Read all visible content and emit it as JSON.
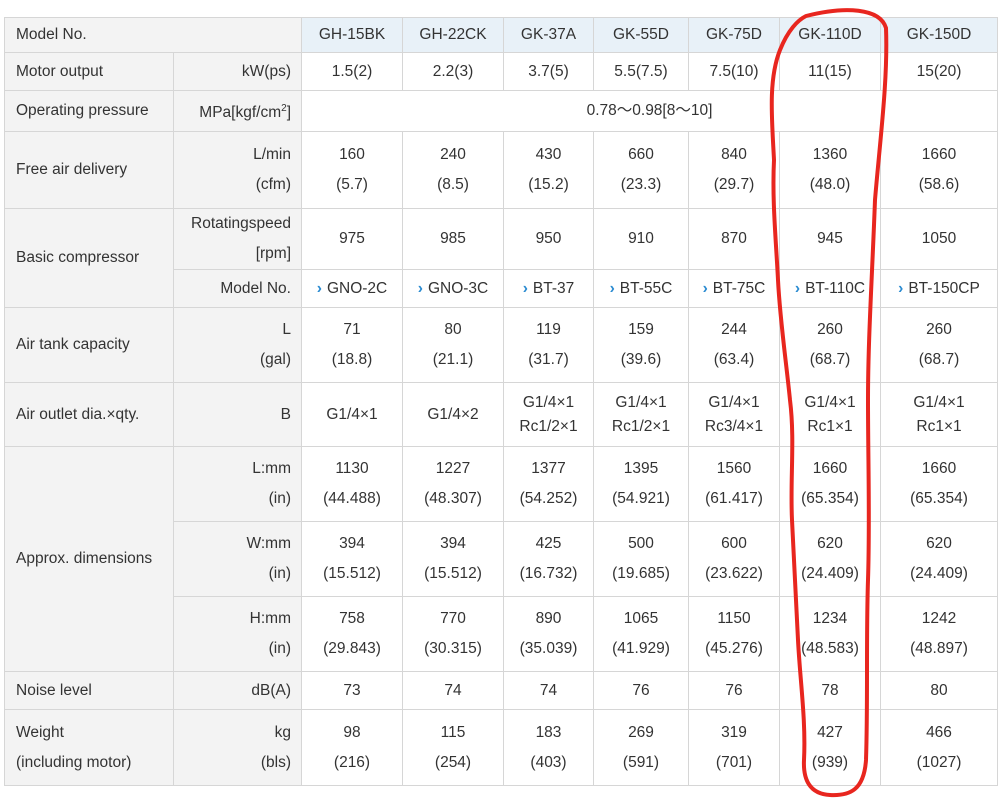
{
  "header": {
    "label": "Model No.",
    "models": [
      "GH-15BK",
      "GH-22CK",
      "GK-37A",
      "GK-55D",
      "GK-75D",
      "GK-110D",
      "GK-150D"
    ]
  },
  "motor_output": {
    "label": "Motor output",
    "unit": "kW(ps)",
    "values": [
      "1.5(2)",
      "2.2(3)",
      "3.7(5)",
      "5.5(7.5)",
      "7.5(10)",
      "11(15)",
      "15(20)"
    ]
  },
  "operating_pressure": {
    "label": "Operating pressure",
    "unit_prefix": "MPa[kgf/cm",
    "unit_sup": "2",
    "unit_suffix": "]",
    "value": "0.78〜0.98[8〜10]"
  },
  "free_air_delivery": {
    "label": "Free air delivery",
    "unit1": "L/min",
    "unit2": "(cfm)",
    "values1": [
      "160",
      "240",
      "430",
      "660",
      "840",
      "1360",
      "1660"
    ],
    "values2": [
      "(5.7)",
      "(8.5)",
      "(15.2)",
      "(23.3)",
      "(29.7)",
      "(48.0)",
      "(58.6)"
    ]
  },
  "basic_compressor": {
    "label": "Basic compressor",
    "speed_unit1": "Rotatingspeed",
    "speed_unit2": "[rpm]",
    "speed_values": [
      "975",
      "985",
      "950",
      "910",
      "870",
      "945",
      "1050"
    ],
    "model_unit": "Model No.",
    "model_links": [
      "GNO-2C",
      "GNO-3C",
      "BT-37",
      "BT-55C",
      "BT-75C",
      "BT-110C",
      "BT-150CP"
    ]
  },
  "air_tank": {
    "label": "Air tank capacity",
    "unit1": "L",
    "unit2": "(gal)",
    "values1": [
      "71",
      "80",
      "119",
      "159",
      "244",
      "260",
      "260"
    ],
    "values2": [
      "(18.8)",
      "(21.1)",
      "(31.7)",
      "(39.6)",
      "(63.4)",
      "(68.7)",
      "(68.7)"
    ]
  },
  "air_outlet": {
    "label": "Air outlet dia.×qty.",
    "unit": "B",
    "lines1": [
      "G1/4×1",
      "G1/4×2",
      "G1/4×1",
      "G1/4×1",
      "G1/4×1",
      "G1/4×1",
      "G1/4×1"
    ],
    "lines2": [
      "",
      "",
      "Rc1/2×1",
      "Rc1/2×1",
      "Rc3/4×1",
      "Rc1×1",
      "Rc1×1"
    ]
  },
  "dimensions": {
    "label": "Approx. dimensions",
    "L": {
      "unit1": "L:mm",
      "unit2": "(in)",
      "values1": [
        "1130",
        "1227",
        "1377",
        "1395",
        "1560",
        "1660",
        "1660"
      ],
      "values2": [
        "(44.488)",
        "(48.307)",
        "(54.252)",
        "(54.921)",
        "(61.417)",
        "(65.354)",
        "(65.354)"
      ]
    },
    "W": {
      "unit1": "W:mm",
      "unit2": "(in)",
      "values1": [
        "394",
        "394",
        "425",
        "500",
        "600",
        "620",
        "620"
      ],
      "values2": [
        "(15.512)",
        "(15.512)",
        "(16.732)",
        "(19.685)",
        "(23.622)",
        "(24.409)",
        "(24.409)"
      ]
    },
    "H": {
      "unit1": "H:mm",
      "unit2": "(in)",
      "values1": [
        "758",
        "770",
        "890",
        "1065",
        "1150",
        "1234",
        "1242"
      ],
      "values2": [
        "(29.843)",
        "(30.315)",
        "(35.039)",
        "(41.929)",
        "(45.276)",
        "(48.583)",
        "(48.897)"
      ]
    }
  },
  "noise": {
    "label": "Noise level",
    "unit": "dB(A)",
    "values": [
      "73",
      "74",
      "74",
      "76",
      "76",
      "78",
      "80"
    ]
  },
  "weight": {
    "label1": "Weight",
    "label2": "(including motor)",
    "unit1": "kg",
    "unit2": "(bls)",
    "values1": [
      "98",
      "115",
      "183",
      "269",
      "319",
      "427",
      "466"
    ],
    "values2": [
      "(216)",
      "(254)",
      "(403)",
      "(591)",
      "(701)",
      "(939)",
      "(1027)"
    ]
  },
  "colors": {
    "annotation": "#e8261f",
    "link_chevron": "#2a8bd1",
    "header_bg": "#e8f1f8",
    "label_bg": "#f3f3f3"
  }
}
